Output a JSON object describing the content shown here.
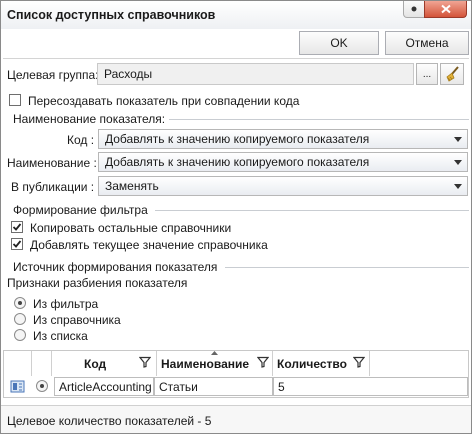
{
  "window": {
    "title": "Список доступных справочников"
  },
  "buttons": {
    "ok": "OK",
    "cancel": "Отмена"
  },
  "target_group": {
    "label": "Целевая группа:",
    "value": "Расходы",
    "browse": "..."
  },
  "recreate": {
    "label": "Пересоздавать показатель при совпадении кода",
    "checked": false
  },
  "naming": {
    "section": "Наименование показателя:",
    "code_label": "Код :",
    "code_value": "Добавлять к значению копируемого показателя",
    "name_label": "Наименование :",
    "name_value": "Добавлять к значению копируемого показателя",
    "pub_label": "В публикации :",
    "pub_value": "Заменять"
  },
  "filter": {
    "section": "Формирование фильтра",
    "copy_label": "Копировать остальные справочники",
    "copy_checked": true,
    "add_label": "Добавлять текущее значение справочника",
    "add_checked": true
  },
  "source": {
    "section": "Источник формирования показателя",
    "split_label": "Признаки разбиения показателя",
    "options": [
      "Из фильтра",
      "Из справочника",
      "Из списка"
    ],
    "selected": "Из фильтра"
  },
  "table": {
    "columns": [
      "Код",
      "Наименование",
      "Количество"
    ],
    "rows": [
      {
        "code": "ArticleAccounting",
        "name": "Статьи",
        "count": "5"
      }
    ]
  },
  "status": {
    "text": "Целевое количество показателей - 5"
  },
  "colors": {
    "close_button": "#d3543a",
    "section_line": "#c9cdd2"
  }
}
